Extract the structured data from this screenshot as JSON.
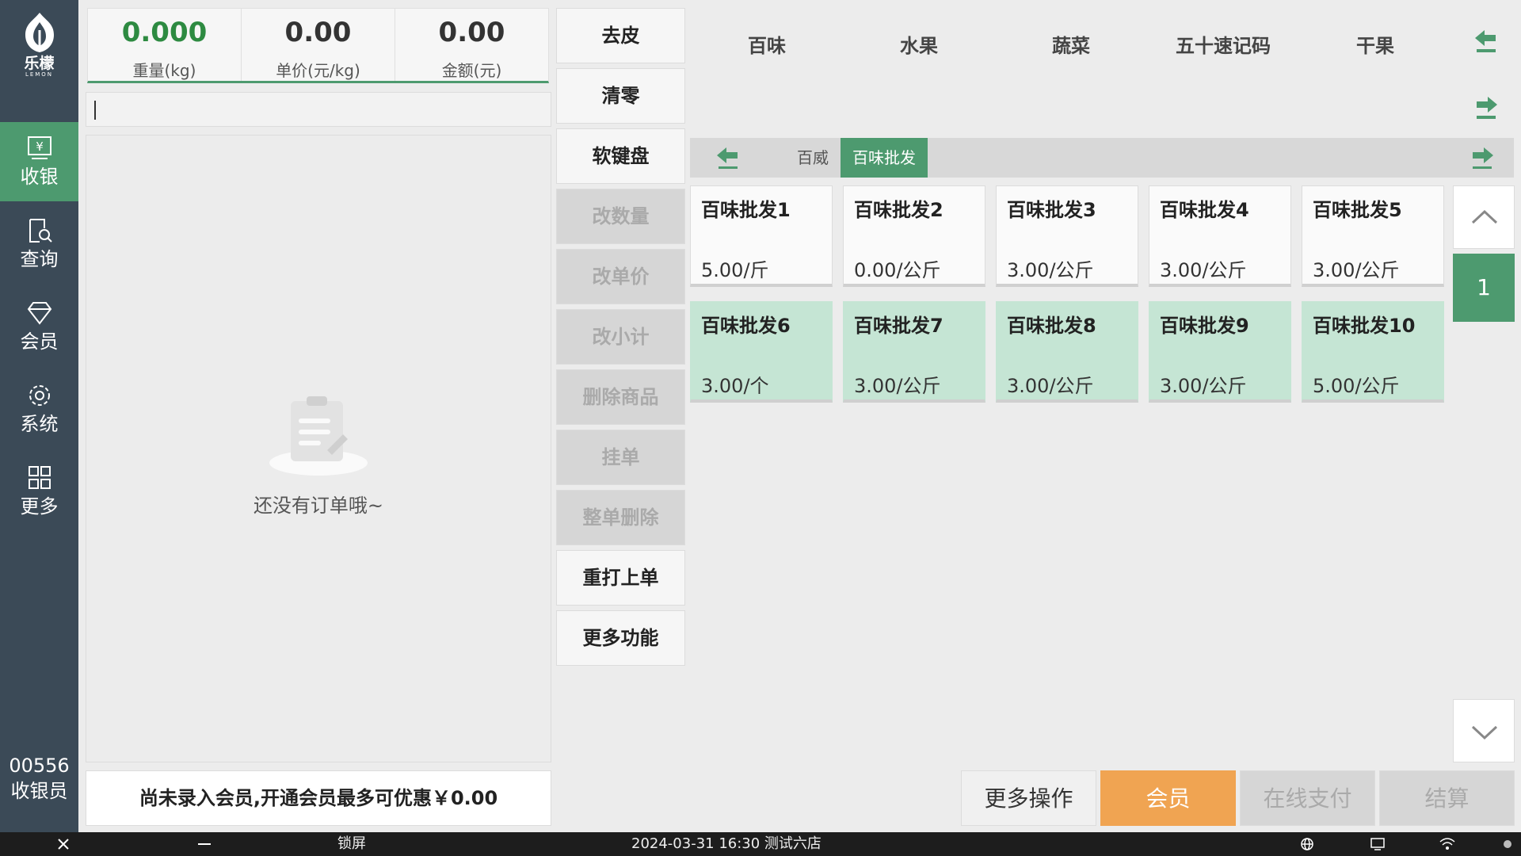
{
  "sidebar": {
    "logo_cn": "乐檬",
    "logo_en": "LEMON",
    "items": [
      {
        "label": "收银",
        "icon": "cash-register-icon"
      },
      {
        "label": "查询",
        "icon": "search-document-icon"
      },
      {
        "label": "会员",
        "icon": "diamond-icon"
      },
      {
        "label": "系统",
        "icon": "gear-icon"
      },
      {
        "label": "更多",
        "icon": "grid-icon"
      }
    ],
    "cashier_id": "00556",
    "cashier_role": "收银员"
  },
  "scale": {
    "weight_value": "0.000",
    "weight_label": "重量(kg)",
    "unit_price_value": "0.00",
    "unit_price_label": "单价(元/kg)",
    "amount_value": "0.00",
    "amount_label": "金额(元)"
  },
  "order": {
    "empty_text": "还没有订单哦~"
  },
  "member_bar": {
    "text": "尚未录入会员,开通会员最多可优惠￥0.00"
  },
  "functions": [
    {
      "label": "去皮",
      "enabled": true
    },
    {
      "label": "清零",
      "enabled": true
    },
    {
      "label": "软键盘",
      "enabled": true
    },
    {
      "label": "改数量",
      "enabled": false
    },
    {
      "label": "改单价",
      "enabled": false
    },
    {
      "label": "改小计",
      "enabled": false
    },
    {
      "label": "删除商品",
      "enabled": false
    },
    {
      "label": "挂单",
      "enabled": false
    },
    {
      "label": "整单删除",
      "enabled": false
    },
    {
      "label": "重打上单",
      "enabled": true
    },
    {
      "label": "更多功能",
      "enabled": true
    }
  ],
  "categories": [
    "百味",
    "水果",
    "蔬菜",
    "五十速记码",
    "干果"
  ],
  "sub_categories": [
    {
      "label": "百威",
      "active": false
    },
    {
      "label": "百味批发",
      "active": true
    }
  ],
  "products": [
    {
      "name": "百味批发1",
      "price": "5.00/斤"
    },
    {
      "name": "百味批发2",
      "price": "0.00/公斤"
    },
    {
      "name": "百味批发3",
      "price": "3.00/公斤"
    },
    {
      "name": "百味批发4",
      "price": "3.00/公斤"
    },
    {
      "name": "百味批发5",
      "price": "3.00/公斤"
    },
    {
      "name": "百味批发6",
      "price": "3.00/个"
    },
    {
      "name": "百味批发7",
      "price": "3.00/公斤"
    },
    {
      "name": "百味批发8",
      "price": "3.00/公斤"
    },
    {
      "name": "百味批发9",
      "price": "3.00/公斤"
    },
    {
      "name": "百味批发10",
      "price": "5.00/公斤"
    }
  ],
  "pagination": {
    "current_page": "1"
  },
  "actions": {
    "more": "更多操作",
    "member": "会员",
    "online_pay": "在线支付",
    "settle": "结算"
  },
  "statusbar": {
    "lock": "锁屏",
    "datetime_store": "2024-03-31 16:30 测试六店"
  },
  "colors": {
    "accent_green": "#4d9a6f",
    "member_orange": "#f0a452",
    "sidebar_bg": "#3b4a57"
  }
}
